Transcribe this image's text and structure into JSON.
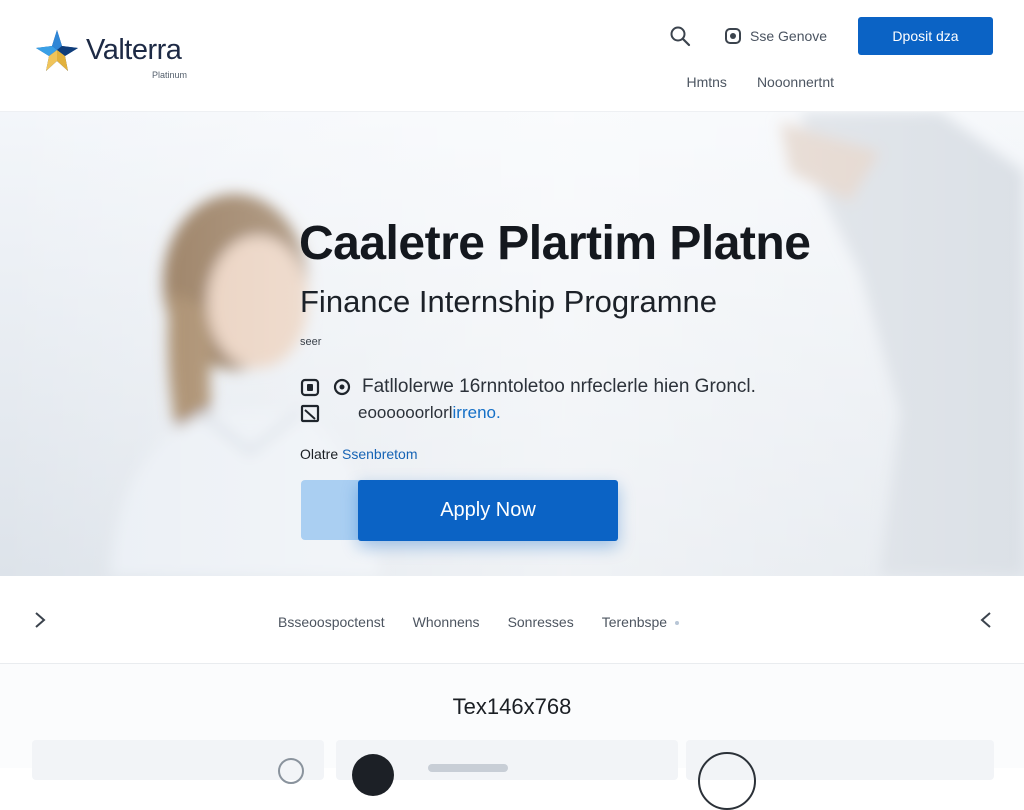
{
  "brand": {
    "name": "Valterra",
    "tagline": "Platinum",
    "accent": "#0b63c5",
    "logo_icon": "star-compass-icon"
  },
  "header": {
    "search_icon": "search-icon",
    "language_icon": "globe-icon",
    "language_label": "Sse Genove",
    "cta_label": "Dposit dza",
    "subnav": [
      "Hmtns",
      "Nooonnertnt"
    ]
  },
  "hero": {
    "title": "Caaletre Plartim Platne",
    "subtitle": "Finance Internship Programne",
    "tag": "seer",
    "row1_icon": "briefcase-icon",
    "row1_icon2": "location-icon",
    "row1_text": "Fatllolerwe 16rnntoletoo nrfeclerle hien Groncl.",
    "row2_icon": "calendar-icon",
    "row2_text": "eoooooorlorl",
    "row2_link": "irreno.",
    "meta_label": "Olatre",
    "meta_value": "Ssenbretom",
    "apply_label": "Apply Now"
  },
  "tabs": {
    "prev_icon": "chevron-right-icon",
    "next_icon": "chevron-left-icon",
    "items": [
      {
        "label": "Bsseoospoctenst"
      },
      {
        "label": "Whonnens"
      },
      {
        "label": "Sonresses"
      },
      {
        "label": "Terenbspe"
      }
    ],
    "active_index": 3
  },
  "lower": {
    "title": "Tex146x768"
  },
  "colors": {
    "primary": "#0b63c5",
    "ghost": "#aacff2",
    "link": "#1570c7"
  }
}
